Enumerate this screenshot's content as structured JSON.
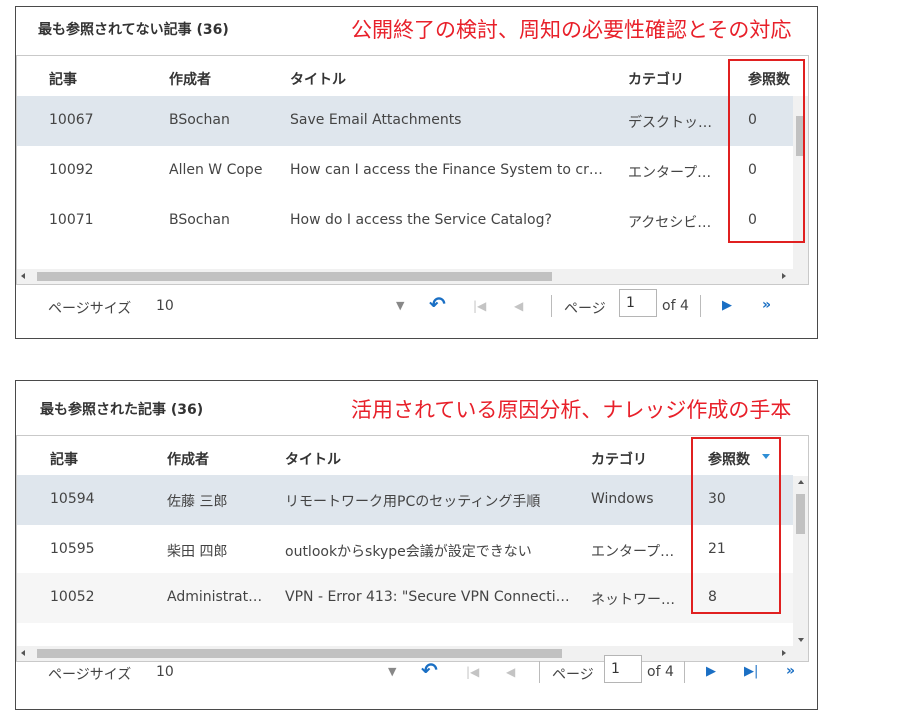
{
  "colors": {
    "annotation_red": "#e8202a",
    "selected_row": "#dfe6ed",
    "pager_blue": "#1a6fc4",
    "sort_arrow": "#2f8fd6"
  },
  "least_viewed": {
    "title": "最も参照されてない記事 (36)",
    "annotation": "公開終了の検討、周知の必要性確認とその対応",
    "columns": [
      "記事",
      "作成者",
      "タイトル",
      "カテゴリ",
      "参照数"
    ],
    "rows": [
      {
        "id": "10067",
        "author": "BSochan",
        "title": "Save Email Attachments",
        "category": "デスクトッ…",
        "views": "0"
      },
      {
        "id": "10092",
        "author": "Allen W Cope",
        "title": "How can I access the Finance System to cr…",
        "category": "エンタープ…",
        "views": "0"
      },
      {
        "id": "10071",
        "author": "BSochan",
        "title": "How do I access the Service Catalog?",
        "category": "アクセシビ…",
        "views": "0"
      }
    ],
    "pager": {
      "page_size_label": "ページサイズ",
      "page_size_value": "10",
      "page_label": "ページ",
      "current_page": "1",
      "of_pages": "of 4"
    }
  },
  "most_viewed": {
    "title": "最も参照された記事 (36)",
    "annotation": "活用されている原因分析、ナレッジ作成の手本",
    "columns": [
      "記事",
      "作成者",
      "タイトル",
      "カテゴリ",
      "参照数"
    ],
    "rows": [
      {
        "id": "10594",
        "author": "佐藤 三郎",
        "title": "リモートワーク用PCのセッティング手順",
        "category": "Windows",
        "views": "30"
      },
      {
        "id": "10595",
        "author": "柴田 四郎",
        "title": "outlookからskype会議が設定できない",
        "category": "エンタープ…",
        "views": "21"
      },
      {
        "id": "10052",
        "author": "Administrat…",
        "title": "VPN - Error 413: \"Secure VPN Connecti…",
        "category": "ネットワー…",
        "views": "8"
      }
    ],
    "pager": {
      "page_size_label": "ページサイズ",
      "page_size_value": "10",
      "page_label": "ページ",
      "current_page": "1",
      "of_pages": "of 4"
    }
  },
  "icons": {
    "dropdown": "chevron-down-icon",
    "refresh": "refresh-icon",
    "first": "first-page-icon",
    "prev": "prev-page-icon",
    "next": "next-page-icon",
    "last": "last-page-icon",
    "more": "more-pages-icon"
  }
}
